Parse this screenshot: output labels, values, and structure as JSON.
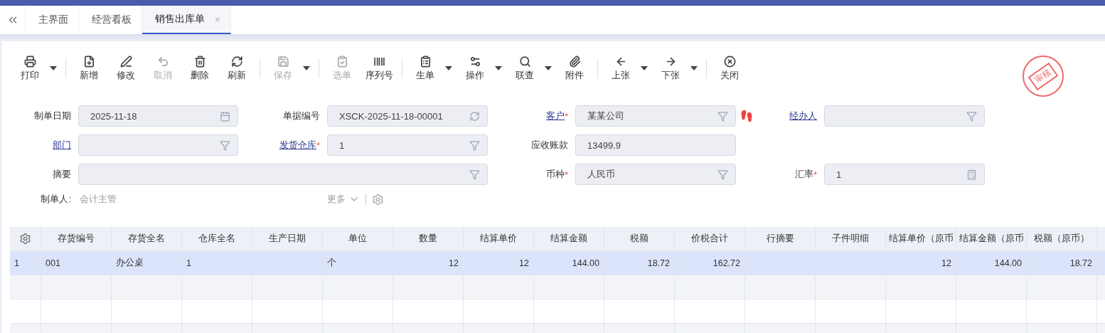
{
  "tabs": [
    {
      "label": "主界面",
      "selected": false
    },
    {
      "label": "经营看板",
      "selected": false
    },
    {
      "label": "销售出库单",
      "selected": true,
      "close": "×"
    }
  ],
  "toolbar": {
    "groups": [
      [
        {
          "label": "打印",
          "disabled": false,
          "dropdown": true
        }
      ],
      [
        {
          "label": "新增",
          "disabled": false,
          "dropdown": false
        },
        {
          "label": "修改",
          "disabled": false,
          "dropdown": false
        },
        {
          "label": "取消",
          "disabled": true,
          "dropdown": false
        },
        {
          "label": "删除",
          "disabled": false,
          "dropdown": false
        },
        {
          "label": "刷新",
          "disabled": false,
          "dropdown": false
        }
      ],
      [
        {
          "label": "保存",
          "disabled": true,
          "dropdown": true
        }
      ],
      [
        {
          "label": "选单",
          "disabled": true,
          "dropdown": false
        },
        {
          "label": "序列号",
          "disabled": false,
          "dropdown": false
        }
      ],
      [
        {
          "label": "生单",
          "disabled": false,
          "dropdown": true
        },
        {
          "label": "操作",
          "disabled": false,
          "dropdown": true
        },
        {
          "label": "联查",
          "disabled": false,
          "dropdown": true
        },
        {
          "label": "附件",
          "disabled": false,
          "dropdown": false
        }
      ],
      [
        {
          "label": "上张",
          "disabled": false,
          "dropdown": true
        },
        {
          "label": "下张",
          "disabled": false,
          "dropdown": true
        }
      ],
      [
        {
          "label": "关闭",
          "disabled": false,
          "dropdown": false
        }
      ]
    ]
  },
  "stamp": {
    "text": "审核"
  },
  "form": {
    "rows": [
      [
        {
          "label": "制单日期",
          "link": false,
          "value": "2025-11-18",
          "kind": "date"
        },
        {
          "label": "单据编号",
          "link": false,
          "value": "XSCK-2025-11-18-00001",
          "kind": "code"
        },
        {
          "label": "客户",
          "link": true,
          "mark": "*",
          "value": "某某公司",
          "kind": "lookup",
          "trace": true
        },
        {
          "label": "经办人",
          "link": true,
          "kind": "lookup"
        }
      ],
      [
        {
          "label": "部门",
          "link": true,
          "kind": "lookup"
        },
        {
          "label": "发货仓库",
          "link": true,
          "mark": "*",
          "value": "1",
          "kind": "lookup"
        },
        {
          "label": "应收账款",
          "link": false,
          "value": "13499.9",
          "kind": "amount"
        }
      ],
      [
        {
          "label": "摘要",
          "link": false,
          "kind": "lookup",
          "colspan": 2
        },
        {
          "label": "币种",
          "link": false,
          "mark": "*",
          "value": "人民币",
          "kind": "lookup"
        },
        {
          "label": "汇率",
          "link": false,
          "mark": "*",
          "value": "1",
          "kind": "rate"
        }
      ]
    ],
    "maker": {
      "label": "制单人:",
      "value": "会计主管"
    },
    "more": "更多"
  },
  "table": {
    "columns": [
      "存货编号",
      "存货全名",
      "仓库全名",
      "生产日期",
      "单位",
      "数量",
      "结算单价",
      "结算金额",
      "税额",
      "价税合计",
      "行摘要",
      "子件明细",
      "结算单价（原币",
      "结算金额（原币",
      "税额（原币）"
    ],
    "numeric": [
      false,
      false,
      false,
      false,
      false,
      true,
      true,
      true,
      true,
      true,
      false,
      false,
      true,
      true,
      true
    ],
    "rows": [
      {
        "index": "1",
        "selected": true,
        "cells": [
          "001",
          "办公桌",
          "1",
          "",
          "个",
          "12",
          "12",
          "144.00",
          "18.72",
          "162.72",
          "",
          "",
          "12",
          "144.00",
          "18.72"
        ]
      }
    ]
  }
}
